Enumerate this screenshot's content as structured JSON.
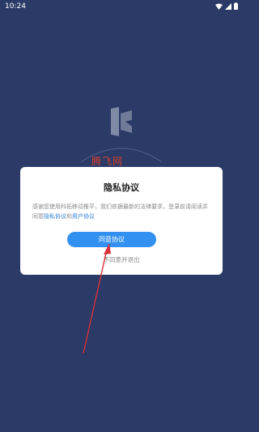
{
  "status_bar": {
    "time": "10:24",
    "icons": [
      "wifi-icon",
      "signal-icon",
      "battery-icon"
    ]
  },
  "background": {
    "color": "#2b3a66",
    "logo_icon": "app-logo-icon",
    "watermark": "腾飞网"
  },
  "privacy_dialog": {
    "title": "隐私协议",
    "body_text": "感谢您使用科拓移动推平，我们依据最新的法律要求，登录前请阅读并同意",
    "privacy_link": "隐私协议",
    "connector": "和",
    "user_agreement_link": "用户协议",
    "agree_button": "同意协议",
    "disagree_button": "不同意并退出",
    "accent_color": "#3290f0"
  },
  "annotation": {
    "arrow_color": "#d8303a"
  }
}
